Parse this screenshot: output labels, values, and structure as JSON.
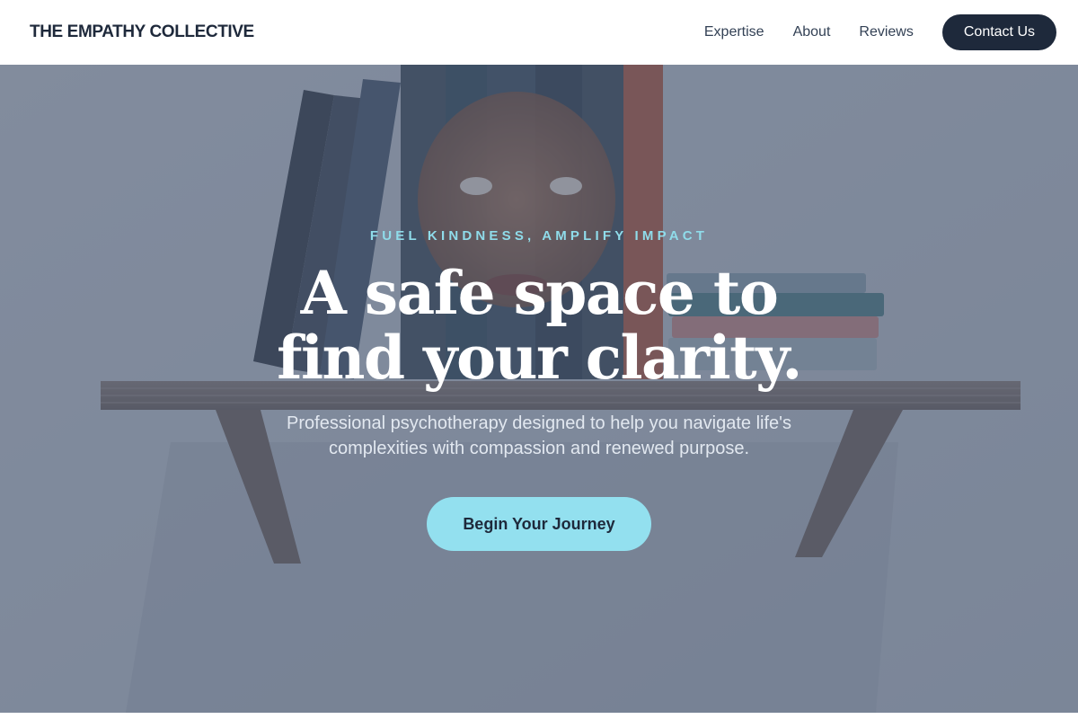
{
  "header": {
    "logo": "THE EMPATHY COLLECTIVE",
    "nav": [
      "Expertise",
      "About",
      "Reviews"
    ],
    "contact_label": "Contact Us"
  },
  "hero": {
    "eyebrow": "FUEL KINDNESS, AMPLIFY IMPACT",
    "headline_line1": "A safe space to",
    "headline_line2": "find your clarity.",
    "subtext": "Professional psychotherapy designed to help you navigate life's complexities with compassion and renewed purpose.",
    "cta_label": "Begin Your Journey"
  },
  "colors": {
    "brand_dark": "#1e293b",
    "accent": "#93e0ef",
    "eyebrow": "#8fdcea"
  }
}
